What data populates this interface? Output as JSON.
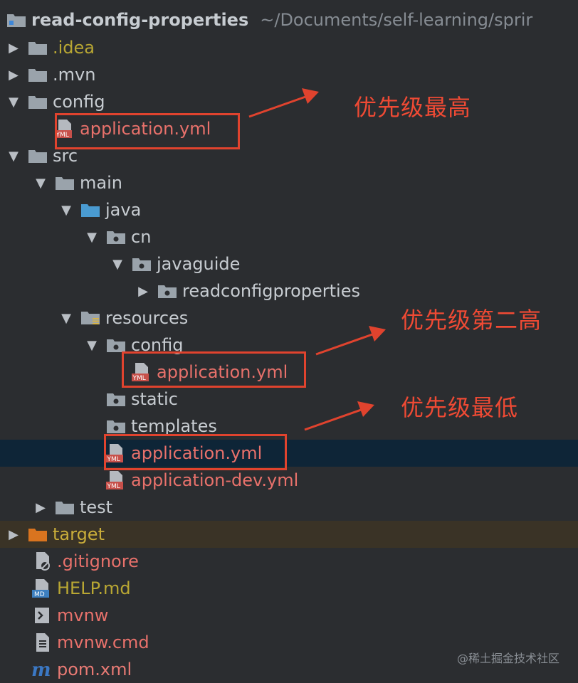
{
  "project": {
    "name": "read-config-properties",
    "path": "~/Documents/self-learning/sprir"
  },
  "tree": {
    "idea": ".idea",
    "mvn": ".mvn",
    "config": "config",
    "config_app": "application.yml",
    "src": "src",
    "main": "main",
    "java": "java",
    "cn": "cn",
    "javaguide": "javaguide",
    "readconfigproperties": "readconfigproperties",
    "resources": "resources",
    "res_config": "config",
    "res_config_app": "application.yml",
    "static": "static",
    "templates": "templates",
    "res_app": "application.yml",
    "res_app_dev": "application-dev.yml",
    "test": "test",
    "target": "target",
    "gitignore": ".gitignore",
    "help": "HELP.md",
    "mvnw": "mvnw",
    "mvnw_cmd": "mvnw.cmd",
    "pom": "pom.xml"
  },
  "annotations": {
    "highest": "优先级最高",
    "second": "优先级第二高",
    "lowest": "优先级最低"
  },
  "watermark": "@稀土掘金技术社区",
  "colors": {
    "background": "#2b2d30",
    "selected_row": "#0e2537",
    "annotation": "#e0432e",
    "yml_text": "#e8716b"
  }
}
